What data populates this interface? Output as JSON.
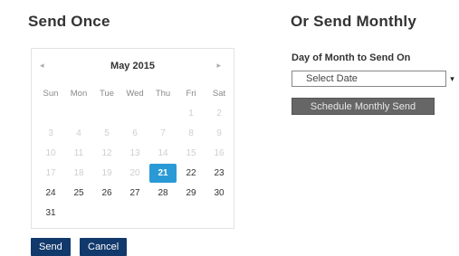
{
  "send_once": {
    "title": "Send Once",
    "calendar": {
      "prev": "◂",
      "next": "▸",
      "month_label": "May 2015",
      "weekdays": [
        "Sun",
        "Mon",
        "Tue",
        "Wed",
        "Thu",
        "Fri",
        "Sat"
      ],
      "days": [
        [
          "",
          "",
          "",
          "",
          "",
          "1",
          "2"
        ],
        [
          "3",
          "4",
          "5",
          "6",
          "7",
          "8",
          "9"
        ],
        [
          "10",
          "11",
          "12",
          "13",
          "14",
          "15",
          "16"
        ],
        [
          "17",
          "18",
          "19",
          "20",
          "21",
          "22",
          "23"
        ],
        [
          "24",
          "25",
          "26",
          "27",
          "28",
          "29",
          "30"
        ],
        [
          "31",
          "",
          "",
          "",
          "",
          "",
          ""
        ]
      ],
      "selected": "21"
    },
    "send_label": "Send",
    "cancel_label": "Cancel"
  },
  "send_monthly": {
    "title": "Or Send Monthly",
    "field_label": "Day of Month to Send On",
    "select_value": "Select Date",
    "schedule_label": "Schedule Monthly Send"
  }
}
